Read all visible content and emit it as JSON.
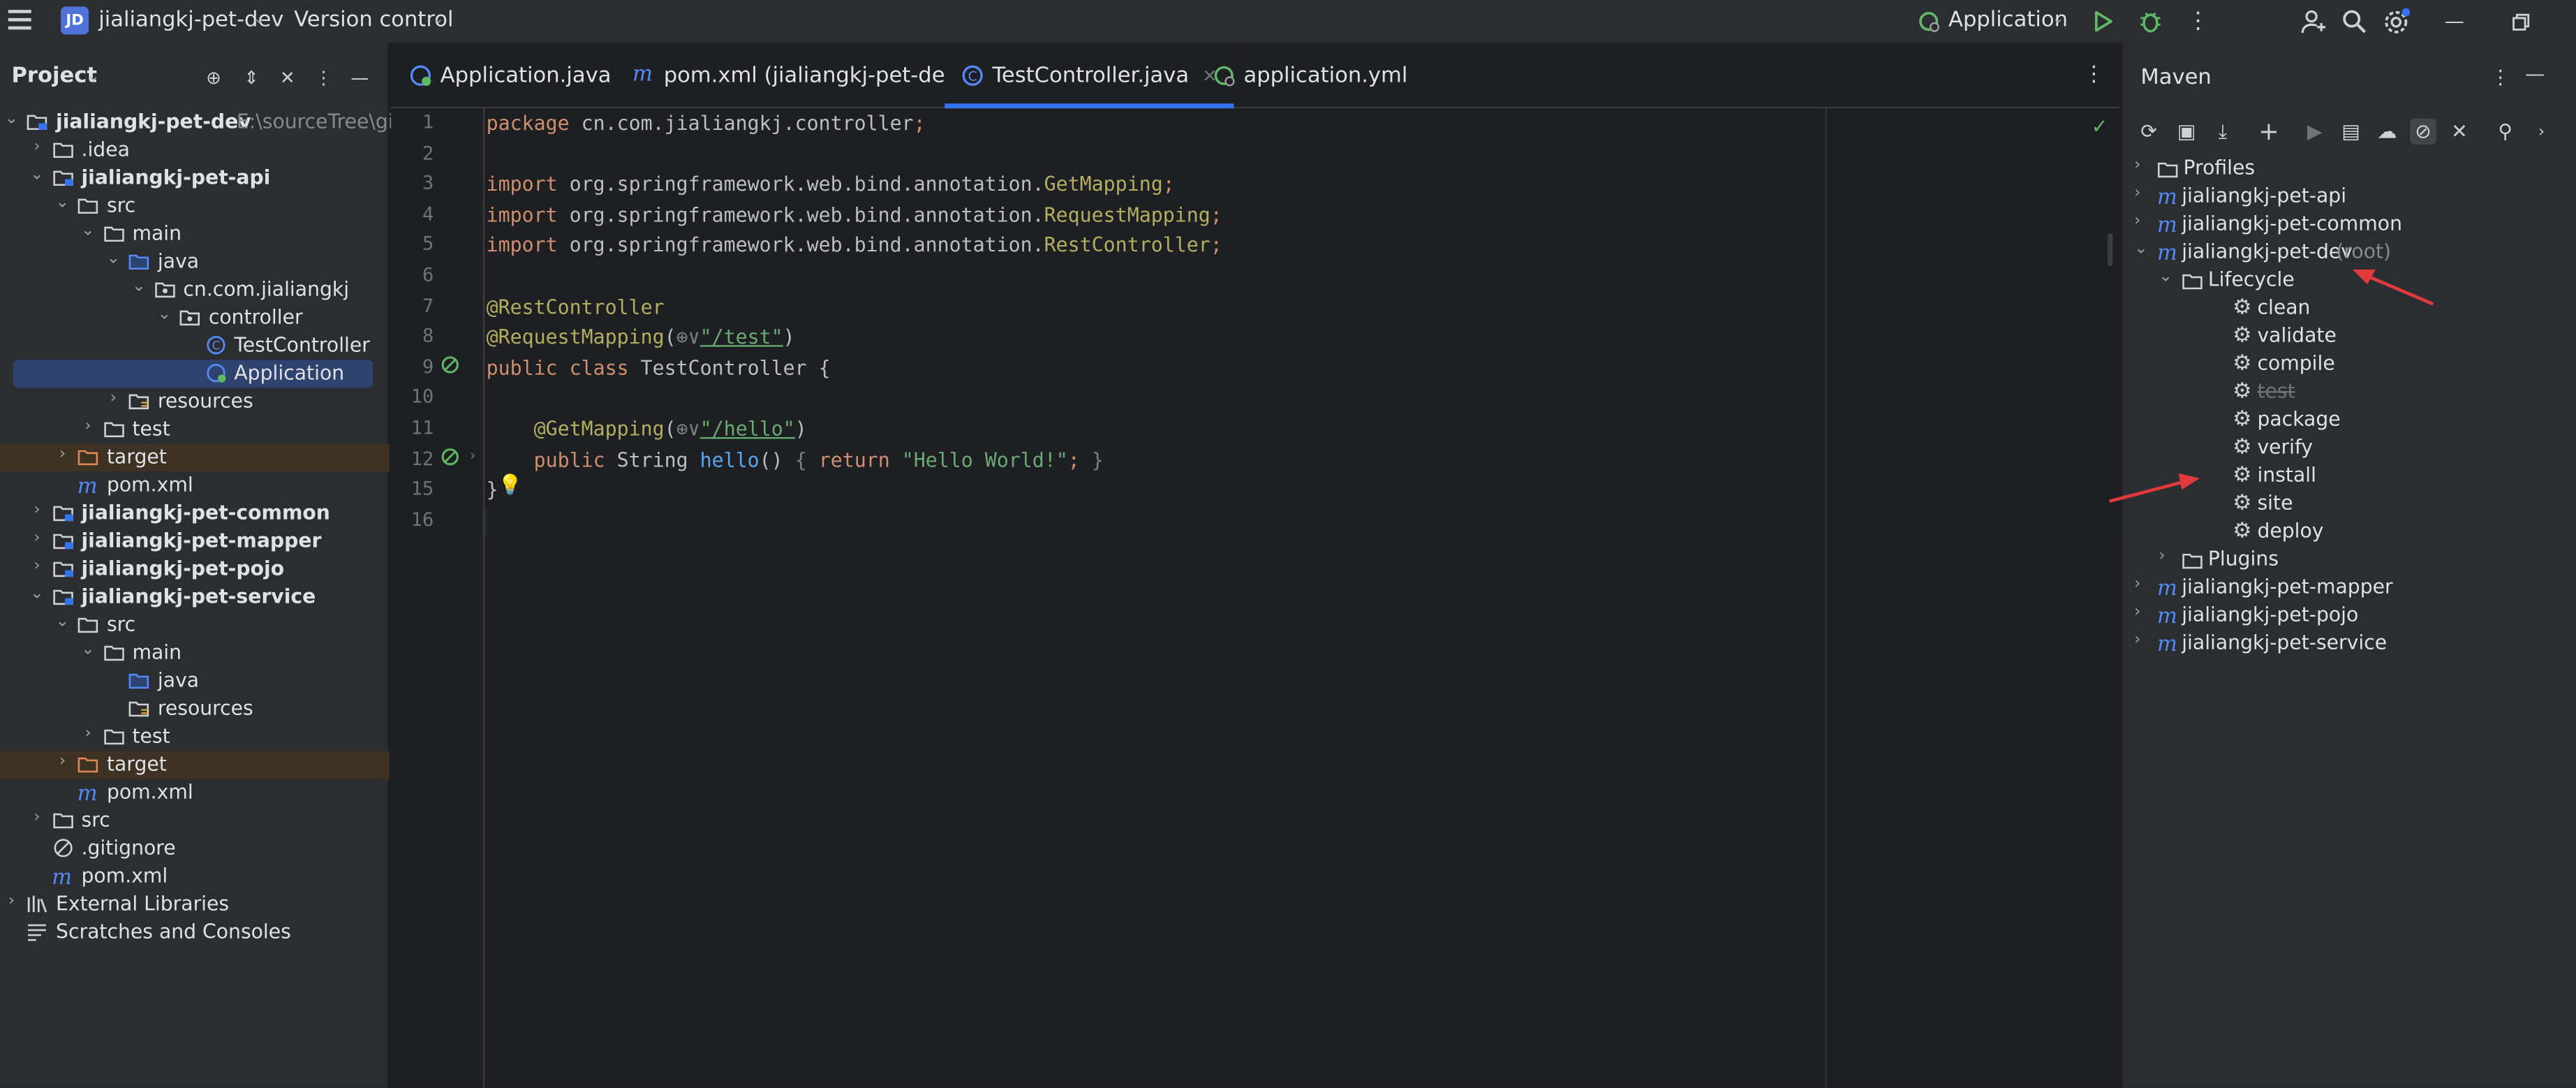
{
  "titlebar": {
    "project_badge": "JD",
    "project_name": "jialiangkj-pet-dev",
    "version_control": "Version control",
    "run_config": "Application"
  },
  "project_panel": {
    "title": "Project",
    "tree": [
      {
        "label": "jialiangkj-pet-dev",
        "suffix": "E:\\sourceTree\\gite",
        "bold": true,
        "indent": 0,
        "chev": "down",
        "icon": "module-folder"
      },
      {
        "label": ".idea",
        "indent": 1,
        "chev": "right",
        "icon": "folder"
      },
      {
        "label": "jialiangkj-pet-api",
        "bold": true,
        "indent": 1,
        "chev": "down",
        "icon": "module-folder"
      },
      {
        "label": "src",
        "indent": 2,
        "chev": "down",
        "icon": "folder"
      },
      {
        "label": "main",
        "indent": 3,
        "chev": "down",
        "icon": "folder"
      },
      {
        "label": "java",
        "indent": 4,
        "chev": "down",
        "icon": "source-folder"
      },
      {
        "label": "cn.com.jialiangkj",
        "indent": 5,
        "chev": "down",
        "icon": "package"
      },
      {
        "label": "controller",
        "indent": 6,
        "chev": "down",
        "icon": "package"
      },
      {
        "label": "TestController",
        "indent": 7,
        "chev": "none",
        "icon": "class"
      },
      {
        "label": "Application",
        "indent": 7,
        "chev": "none",
        "icon": "spring-class",
        "selected": true
      },
      {
        "label": "resources",
        "indent": 4,
        "chev": "right",
        "icon": "resources-folder"
      },
      {
        "label": "test",
        "indent": 3,
        "chev": "right",
        "icon": "folder"
      },
      {
        "label": "target",
        "indent": 2,
        "chev": "right",
        "icon": "target-folder",
        "excluded": true
      },
      {
        "label": "pom.xml",
        "indent": 2,
        "chev": "none",
        "icon": "maven"
      },
      {
        "label": "jialiangkj-pet-common",
        "bold": true,
        "indent": 1,
        "chev": "right",
        "icon": "module-folder"
      },
      {
        "label": "jialiangkj-pet-mapper",
        "bold": true,
        "indent": 1,
        "chev": "right",
        "icon": "module-folder"
      },
      {
        "label": "jialiangkj-pet-pojo",
        "bold": true,
        "indent": 1,
        "chev": "right",
        "icon": "module-folder"
      },
      {
        "label": "jialiangkj-pet-service",
        "bold": true,
        "indent": 1,
        "chev": "down",
        "icon": "module-folder"
      },
      {
        "label": "src",
        "indent": 2,
        "chev": "down",
        "icon": "folder"
      },
      {
        "label": "main",
        "indent": 3,
        "chev": "down",
        "icon": "folder"
      },
      {
        "label": "java",
        "indent": 4,
        "chev": "none",
        "icon": "source-folder"
      },
      {
        "label": "resources",
        "indent": 4,
        "chev": "none",
        "icon": "resources-folder"
      },
      {
        "label": "test",
        "indent": 3,
        "chev": "right",
        "icon": "folder"
      },
      {
        "label": "target",
        "indent": 2,
        "chev": "right",
        "icon": "target-folder",
        "excluded": true
      },
      {
        "label": "pom.xml",
        "indent": 2,
        "chev": "none",
        "icon": "maven"
      },
      {
        "label": "src",
        "indent": 1,
        "chev": "right",
        "icon": "folder"
      },
      {
        "label": ".gitignore",
        "indent": 1,
        "chev": "none",
        "icon": "ignore"
      },
      {
        "label": "pom.xml",
        "indent": 1,
        "chev": "none",
        "icon": "maven"
      },
      {
        "label": "External Libraries",
        "indent": 0,
        "chev": "right",
        "icon": "library"
      },
      {
        "label": "Scratches and Consoles",
        "indent": 0,
        "chev": "none",
        "icon": "scratches"
      }
    ]
  },
  "editor": {
    "tabs": [
      {
        "label": "Application.java",
        "icon": "spring-class"
      },
      {
        "label": "pom.xml (jialiangkj-pet-dev)",
        "icon": "maven"
      },
      {
        "label": "TestController.java",
        "icon": "class",
        "active": true
      },
      {
        "label": "application.yml",
        "icon": "spring-leaf"
      }
    ],
    "lines": [
      {
        "n": "1",
        "tokens": [
          [
            "kw",
            "package "
          ],
          [
            "pl",
            "cn.com.jialiangkj.controller"
          ],
          [
            "kw",
            ";"
          ]
        ]
      },
      {
        "n": "2",
        "tokens": []
      },
      {
        "n": "3",
        "tokens": [
          [
            "kw",
            "import "
          ],
          [
            "pl",
            "org.springframework.web.bind.annotation."
          ],
          [
            "an",
            "GetMapping"
          ],
          [
            "kw",
            ";"
          ]
        ]
      },
      {
        "n": "4",
        "tokens": [
          [
            "kw",
            "import "
          ],
          [
            "pl",
            "org.springframework.web.bind.annotation."
          ],
          [
            "an",
            "RequestMapping"
          ],
          [
            "kw",
            ";"
          ]
        ]
      },
      {
        "n": "5",
        "tokens": [
          [
            "kw",
            "import "
          ],
          [
            "pl",
            "org.springframework.web.bind.annotation."
          ],
          [
            "an",
            "RestController"
          ],
          [
            "kw",
            ";"
          ]
        ]
      },
      {
        "n": "6",
        "tokens": []
      },
      {
        "n": "7",
        "tokens": [
          [
            "an",
            "@RestController"
          ]
        ]
      },
      {
        "n": "8",
        "tokens": [
          [
            "an",
            "@RequestMapping"
          ],
          [
            "pl",
            "("
          ],
          [
            "dim",
            "⊕∨"
          ],
          [
            "st",
            "\"/test\""
          ],
          [
            "pl",
            ")"
          ]
        ]
      },
      {
        "n": "9",
        "tokens": [
          [
            "kw",
            "public class "
          ],
          [
            "pl",
            "TestController {"
          ]
        ]
      },
      {
        "n": "10",
        "tokens": []
      },
      {
        "n": "11",
        "tokens": [
          [
            "pl",
            "    "
          ],
          [
            "an",
            "@GetMapping"
          ],
          [
            "pl",
            "("
          ],
          [
            "dim",
            "⊕∨"
          ],
          [
            "st",
            "\"/hello\""
          ],
          [
            "pl",
            ")"
          ]
        ]
      },
      {
        "n": "12",
        "tokens": [
          [
            "pl",
            "    "
          ],
          [
            "kw",
            "public "
          ],
          [
            "pl",
            "String "
          ],
          [
            "fn",
            "hello"
          ],
          [
            "pl",
            "() "
          ],
          [
            "dim",
            "{ "
          ],
          [
            "kw",
            "return "
          ],
          [
            "st",
            "\"Hello World!\""
          ],
          [
            "kw",
            "; "
          ],
          [
            "dim",
            "}"
          ]
        ]
      },
      {
        "n": "15",
        "tokens": [
          [
            "pl",
            "}"
          ]
        ]
      },
      {
        "n": "16",
        "tokens": []
      }
    ]
  },
  "maven": {
    "title": "Maven",
    "rows": [
      {
        "label": "Profiles",
        "indent": 0,
        "chev": "right",
        "icon": "folder"
      },
      {
        "label": "jialiangkj-pet-api",
        "indent": 0,
        "chev": "right",
        "icon": "m"
      },
      {
        "label": "jialiangkj-pet-common",
        "indent": 0,
        "chev": "right",
        "icon": "m"
      },
      {
        "label": "jialiangkj-pet-dev",
        "suffix": "(root)",
        "indent": 0,
        "chev": "down",
        "icon": "m"
      },
      {
        "label": "Lifecycle",
        "indent": 1,
        "chev": "down",
        "icon": "folder"
      },
      {
        "label": "clean",
        "indent": 2,
        "chev": "none",
        "icon": "gear"
      },
      {
        "label": "validate",
        "indent": 2,
        "chev": "none",
        "icon": "gear"
      },
      {
        "label": "compile",
        "indent": 2,
        "chev": "none",
        "icon": "gear"
      },
      {
        "label": "test",
        "indent": 2,
        "chev": "none",
        "icon": "gear",
        "disabled": true
      },
      {
        "label": "package",
        "indent": 2,
        "chev": "none",
        "icon": "gear"
      },
      {
        "label": "verify",
        "indent": 2,
        "chev": "none",
        "icon": "gear"
      },
      {
        "label": "install",
        "indent": 2,
        "chev": "none",
        "icon": "gear"
      },
      {
        "label": "site",
        "indent": 2,
        "chev": "none",
        "icon": "gear"
      },
      {
        "label": "deploy",
        "indent": 2,
        "chev": "none",
        "icon": "gear"
      },
      {
        "label": "Plugins",
        "indent": 1,
        "chev": "right",
        "icon": "folder"
      },
      {
        "label": "jialiangkj-pet-mapper",
        "indent": 0,
        "chev": "right",
        "icon": "m"
      },
      {
        "label": "jialiangkj-pet-pojo",
        "indent": 0,
        "chev": "right",
        "icon": "m"
      },
      {
        "label": "jialiangkj-pet-service",
        "indent": 0,
        "chev": "right",
        "icon": "m"
      }
    ]
  },
  "colors": {
    "accent": "#3574f0",
    "annotation_arrow": "#e0393e",
    "ok": "#5fb865"
  }
}
